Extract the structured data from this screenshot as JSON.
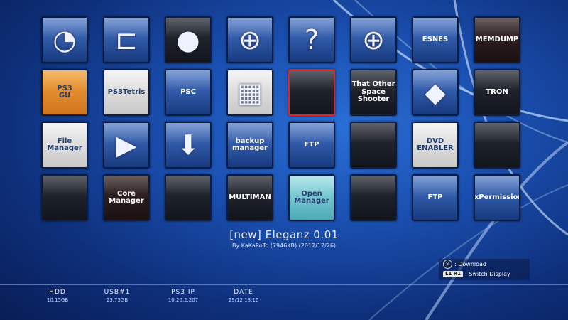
{
  "app": {
    "selected_title": "[new] Eleganz 0.01",
    "selected_byline": "By KaKaRoTo (7946KB) (2012/12/26)"
  },
  "grid": [
    {
      "name": "network-app",
      "style": "blue",
      "glyph": "◔",
      "label": ""
    },
    {
      "name": "showtime-app",
      "style": "blue",
      "glyph": "⊏",
      "label": ""
    },
    {
      "name": "bomb-game",
      "style": "dark",
      "glyph": "●",
      "label": ""
    },
    {
      "name": "web-browser",
      "style": "blue",
      "glyph": "⊕",
      "label": ""
    },
    {
      "name": "unknown-app",
      "style": "blue",
      "glyph": "?",
      "label": ""
    },
    {
      "name": "web-browser-2",
      "style": "blue",
      "glyph": "⊕",
      "label": ""
    },
    {
      "name": "psp-emulator",
      "style": "blue",
      "glyph": "",
      "label": "ESNES"
    },
    {
      "name": "memdump",
      "style": "red",
      "glyph": "",
      "label": "MEMDUMP"
    },
    {
      "name": "ps3-gui",
      "style": "orange",
      "glyph": "",
      "label": "PS3\nGU"
    },
    {
      "name": "ps3tetris",
      "style": "light",
      "glyph": "",
      "label": "PS3Tetris"
    },
    {
      "name": "psc-package",
      "style": "blue",
      "glyph": "",
      "label": "PSC"
    },
    {
      "name": "pixel-app",
      "style": "light",
      "glyph": "▦",
      "label": ""
    },
    {
      "name": "eleganz",
      "style": "dark",
      "glyph": "",
      "label": "",
      "selected": true
    },
    {
      "name": "that-other-space-shooter",
      "style": "dark",
      "glyph": "",
      "label": "That Other\nSpace\nShooter"
    },
    {
      "name": "package-app",
      "style": "blue",
      "glyph": "◆",
      "label": ""
    },
    {
      "name": "tron",
      "style": "dark",
      "glyph": "",
      "label": "TRON"
    },
    {
      "name": "file-manager",
      "style": "light",
      "glyph": "",
      "label": "File\nManager"
    },
    {
      "name": "media-app",
      "style": "blue",
      "glyph": "▶",
      "label": ""
    },
    {
      "name": "download-app",
      "style": "blue",
      "glyph": "⬇",
      "label": ""
    },
    {
      "name": "backup-manager",
      "style": "blue",
      "glyph": "",
      "label": "backup\nmanager"
    },
    {
      "name": "ftp-app",
      "style": "blue",
      "glyph": "",
      "label": "FTP"
    },
    {
      "name": "media-browser",
      "style": "dark",
      "glyph": "",
      "label": ""
    },
    {
      "name": "dvd-enabler",
      "style": "light",
      "glyph": "",
      "label": "DVD\nENABLER"
    },
    {
      "name": "xmb-theme",
      "style": "dark",
      "glyph": "",
      "label": ""
    },
    {
      "name": "covers-app",
      "style": "dark",
      "glyph": "",
      "label": ""
    },
    {
      "name": "core-manager",
      "style": "red",
      "glyph": "",
      "label": "Core\nManager"
    },
    {
      "name": "game-list",
      "style": "dark",
      "glyph": "",
      "label": ""
    },
    {
      "name": "multiman",
      "style": "dark",
      "glyph": "",
      "label": "MULTIMAN"
    },
    {
      "name": "open-manager",
      "style": "teal",
      "glyph": "",
      "label": "Open\nManager"
    },
    {
      "name": "dark-app",
      "style": "dark",
      "glyph": "",
      "label": ""
    },
    {
      "name": "ftp-tools",
      "style": "blue",
      "glyph": "",
      "label": "FTP"
    },
    {
      "name": "fix-permissions",
      "style": "blue",
      "glyph": "",
      "label": "FixPermissions"
    }
  ],
  "hints": [
    {
      "button": "✕",
      "label": ": Download"
    },
    {
      "button": "L1 R1",
      "label": ": Switch Display"
    }
  ],
  "status": [
    {
      "key": "HDD",
      "value": "10.15GB"
    },
    {
      "key": "USB#1",
      "value": "23.75GB"
    },
    {
      "key": "PS3 IP",
      "value": "10.20.2.207"
    },
    {
      "key": "DATE",
      "value": "29/12 18:16"
    }
  ]
}
